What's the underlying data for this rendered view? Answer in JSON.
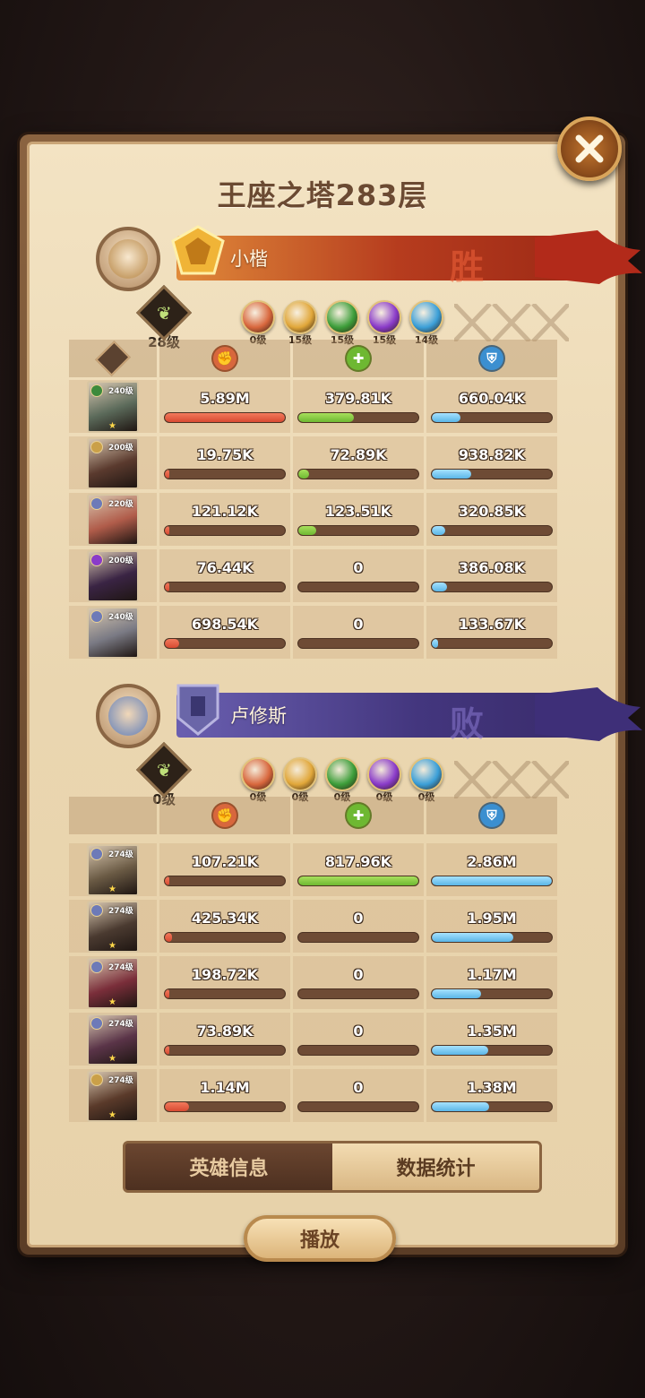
{
  "title": "王座之塔283层",
  "close_label": "✕",
  "teams": [
    {
      "name": "小楷",
      "result": "胜",
      "level": "28级",
      "orbs": [
        {
          "color": "#d8673d",
          "level": "0级"
        },
        {
          "color": "#e1a73a",
          "level": "15级"
        },
        {
          "color": "#3d9e3a",
          "level": "15级"
        },
        {
          "color": "#8a3bc9",
          "level": "15级"
        },
        {
          "color": "#3b9fd8",
          "level": "14级"
        }
      ],
      "rows": [
        {
          "hero_level": "240级",
          "faction_color": "#3c8a3c",
          "hero_color": "#5b6a5a",
          "star": "★",
          "damage": "5.89M",
          "damage_pct": 1.0,
          "heal": "379.81K",
          "heal_pct": 0.46,
          "tank": "660.04K",
          "tank_pct": 0.24
        },
        {
          "hero_level": "200级",
          "faction_color": "#caa048",
          "hero_color": "#5a3a2e",
          "star": "",
          "damage": "19.75K",
          "damage_pct": 0.01,
          "heal": "72.89K",
          "heal_pct": 0.09,
          "tank": "938.82K",
          "tank_pct": 0.33
        },
        {
          "hero_level": "220级",
          "faction_color": "#6d7ab8",
          "hero_color": "#b05c4a",
          "star": "",
          "damage": "121.12K",
          "damage_pct": 0.02,
          "heal": "123.51K",
          "heal_pct": 0.15,
          "tank": "320.85K",
          "tank_pct": 0.11
        },
        {
          "hero_level": "200级",
          "faction_color": "#8a3bc9",
          "hero_color": "#3a2444",
          "star": "",
          "damage": "76.44K",
          "damage_pct": 0.01,
          "heal": "0",
          "heal_pct": 0,
          "tank": "386.08K",
          "tank_pct": 0.13
        },
        {
          "hero_level": "240级",
          "faction_color": "#6d7ab8",
          "hero_color": "#7a7a84",
          "star": "",
          "damage": "698.54K",
          "damage_pct": 0.12,
          "heal": "0",
          "heal_pct": 0,
          "tank": "133.67K",
          "tank_pct": 0.05
        }
      ]
    },
    {
      "name": "卢修斯",
      "result": "败",
      "level": "0级",
      "orbs": [
        {
          "color": "#d8673d",
          "level": "0级"
        },
        {
          "color": "#e1a73a",
          "level": "0级"
        },
        {
          "color": "#3d9e3a",
          "level": "0级"
        },
        {
          "color": "#8a3bc9",
          "level": "0级"
        },
        {
          "color": "#3b9fd8",
          "level": "0级"
        }
      ],
      "rows": [
        {
          "hero_level": "274级",
          "faction_color": "#6d7ab8",
          "hero_color": "#6a5a44",
          "star": "★",
          "damage": "107.21K",
          "damage_pct": 0.03,
          "heal": "817.96K",
          "heal_pct": 1.0,
          "tank": "2.86M",
          "tank_pct": 1.0
        },
        {
          "hero_level": "274级",
          "faction_color": "#6d7ab8",
          "hero_color": "#4a3a30",
          "star": "★",
          "damage": "425.34K",
          "damage_pct": 0.06,
          "heal": "0",
          "heal_pct": 0,
          "tank": "1.95M",
          "tank_pct": 0.68
        },
        {
          "hero_level": "274级",
          "faction_color": "#6d7ab8",
          "hero_color": "#7a2e3a",
          "star": "★",
          "damage": "198.72K",
          "damage_pct": 0.03,
          "heal": "0",
          "heal_pct": 0,
          "tank": "1.17M",
          "tank_pct": 0.41
        },
        {
          "hero_level": "274级",
          "faction_color": "#6d7ab8",
          "hero_color": "#5a3448",
          "star": "★",
          "damage": "73.89K",
          "damage_pct": 0.01,
          "heal": "0",
          "heal_pct": 0,
          "tank": "1.35M",
          "tank_pct": 0.47
        },
        {
          "hero_level": "274级",
          "faction_color": "#caa048",
          "hero_color": "#5a3a2a",
          "star": "★",
          "damage": "1.14M",
          "damage_pct": 0.2,
          "heal": "0",
          "heal_pct": 0,
          "tank": "1.38M",
          "tank_pct": 0.48
        }
      ]
    }
  ],
  "column_icons": [
    "damage-icon",
    "heal-icon",
    "tank-icon"
  ],
  "tabs": {
    "hero_info": "英雄信息",
    "stats": "数据统计",
    "active": "stats"
  },
  "play_label": "播放"
}
